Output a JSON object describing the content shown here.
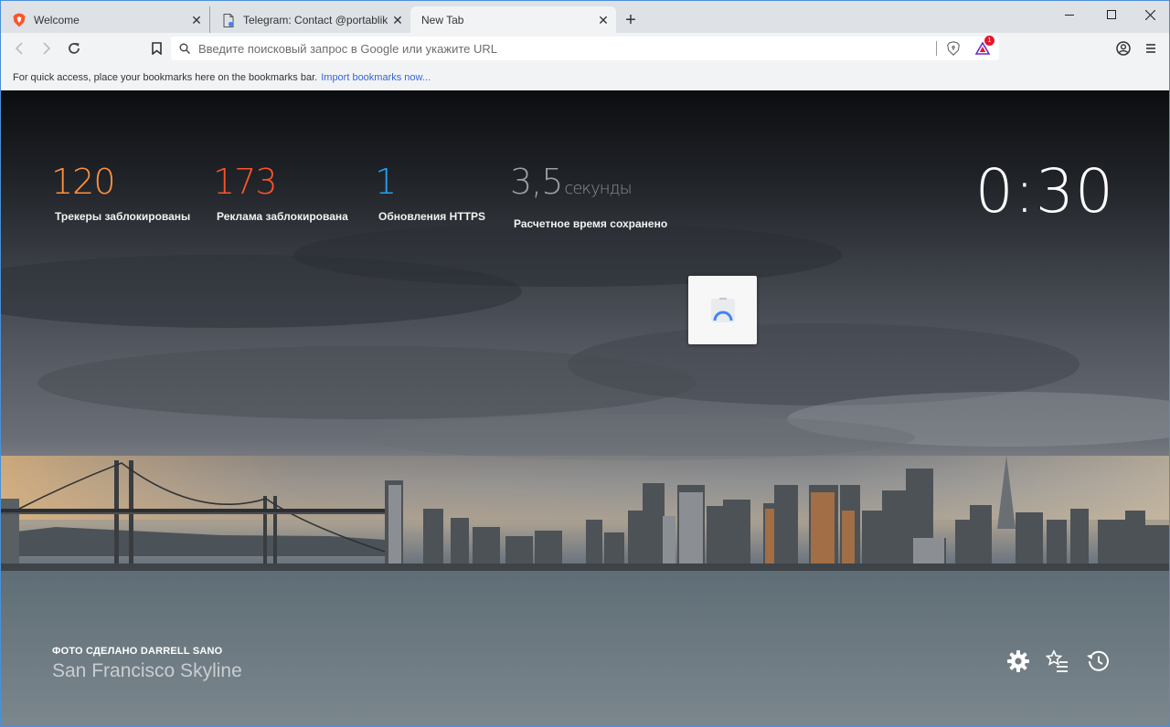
{
  "tabs": [
    {
      "title": "Welcome",
      "favicon": "brave-lion-icon"
    },
    {
      "title": "Telegram: Contact @portablik",
      "favicon": "page-icon"
    },
    {
      "title": "New Tab",
      "favicon": ""
    }
  ],
  "toolbar": {
    "omnibox_placeholder": "Введите поисковый запрос в Google или укажите URL",
    "rewards_badge": "1"
  },
  "bookmarks_bar": {
    "message": "For quick access, place your bookmarks here on the bookmarks bar.",
    "import_link": "Import bookmarks now..."
  },
  "stats": {
    "trackers": {
      "value": "120",
      "label": "Трекеры заблокированы",
      "color": "#fe913f"
    },
    "ads": {
      "value": "173",
      "label": "Реклама заблокирована",
      "color": "#fb542b"
    },
    "https": {
      "value": "1",
      "label": "Обновления HTTPS",
      "color": "#27a0f0"
    },
    "time": {
      "value": "3,5",
      "unit": "секунды",
      "label": "Расчетное время сохранено",
      "color": "#9e9fa3"
    }
  },
  "clock": "0:30",
  "photo_credit": {
    "prefix": "ФОТО СДЕЛАНО",
    "author": "DARRELL SANO",
    "location": "San Francisco Skyline"
  },
  "colors": {
    "accent": "#4a90d9",
    "link": "#3367d6"
  }
}
